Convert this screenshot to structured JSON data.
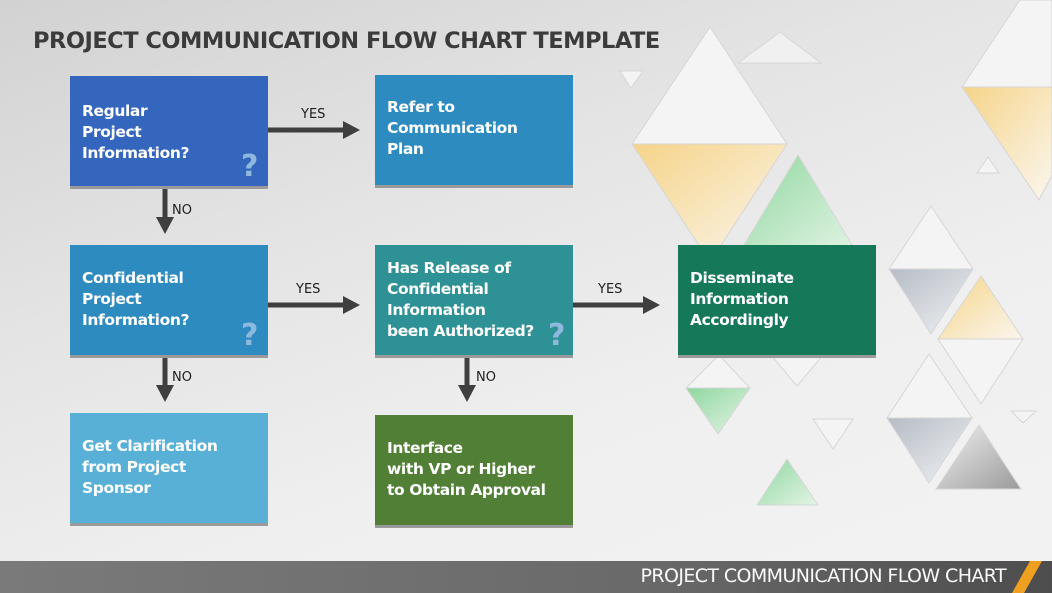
{
  "title": "PROJECT COMMUNICATION FLOW CHART TEMPLATE",
  "footer": {
    "label": "PROJECT COMMUNICATION FLOW CHART",
    "accent_color": "#f0a020"
  },
  "nodes": [
    {
      "id": "regular",
      "text": "Regular\nProject\nInformation?",
      "type": "decision",
      "color": "#3566bd"
    },
    {
      "id": "refer",
      "text": "Refer to\nCommunication\nPlan",
      "type": "process",
      "color": "#2e8bc0"
    },
    {
      "id": "confidential",
      "text": "Confidential\nProject\nInformation?",
      "type": "decision",
      "color": "#2e8bc0"
    },
    {
      "id": "authorized",
      "text": "Has Release of\nConfidential\nInformation\nbeen Authorized?",
      "type": "decision",
      "color": "#2e9196"
    },
    {
      "id": "disseminate",
      "text": "Disseminate\nInformation\nAccordingly",
      "type": "process",
      "color": "#147859"
    },
    {
      "id": "clarify",
      "text": "Get Clarification\nfrom Project\nSponsor",
      "type": "process",
      "color": "#58b0d6"
    },
    {
      "id": "interface",
      "text": "Interface\nwith VP or Higher\nto Obtain Approval",
      "type": "process",
      "color": "#517f35"
    }
  ],
  "edges": [
    {
      "from": "regular",
      "to": "refer",
      "label": "YES"
    },
    {
      "from": "regular",
      "to": "confidential",
      "label": "NO"
    },
    {
      "from": "confidential",
      "to": "authorized",
      "label": "YES"
    },
    {
      "from": "confidential",
      "to": "clarify",
      "label": "NO"
    },
    {
      "from": "authorized",
      "to": "disseminate",
      "label": "YES"
    },
    {
      "from": "authorized",
      "to": "interface",
      "label": "NO"
    }
  ],
  "icons": {
    "decision_marker": "question-mark-icon",
    "decision_glyph": "?"
  }
}
